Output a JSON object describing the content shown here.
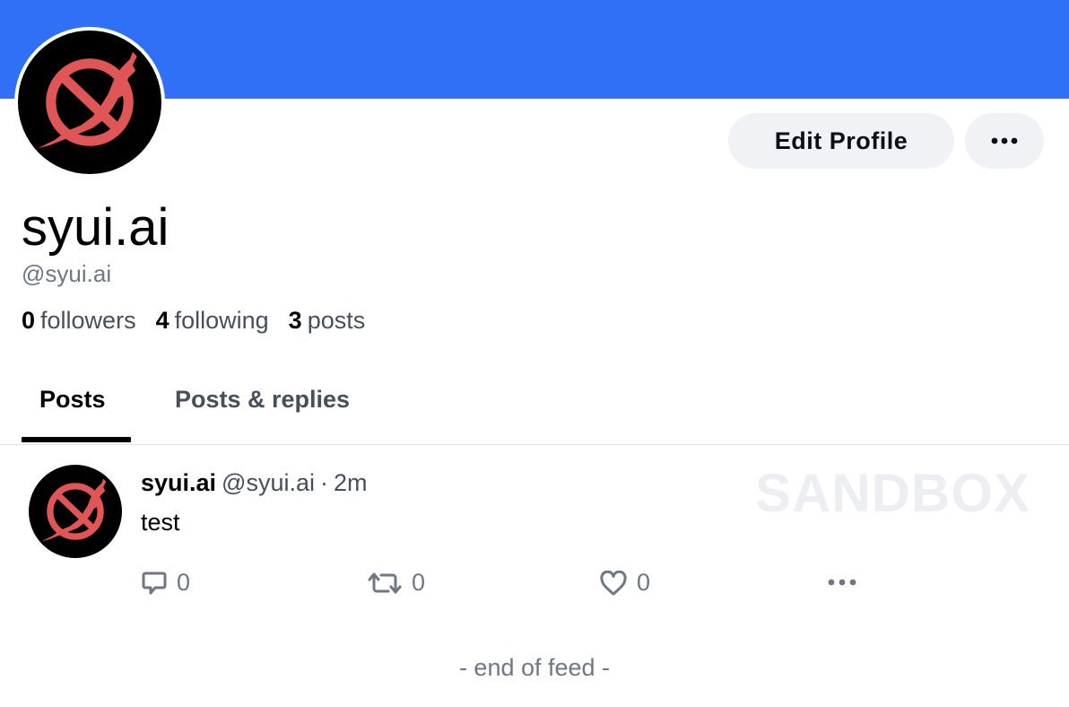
{
  "colors": {
    "banner": "#3070f6",
    "avatar_logo": "#e05656",
    "avatar_bg": "#000000"
  },
  "profile": {
    "display_name": "syui.ai",
    "handle": "@syui.ai",
    "edit_button": "Edit Profile",
    "more_icon": "ellipsis-icon",
    "avatar_icon": "bird-logo-icon",
    "stats": [
      {
        "count": "0",
        "label": "followers"
      },
      {
        "count": "4",
        "label": "following"
      },
      {
        "count": "3",
        "label": "posts"
      }
    ]
  },
  "tabs": [
    {
      "label": "Posts",
      "active": true
    },
    {
      "label": "Posts & replies",
      "active": false
    }
  ],
  "feed": {
    "posts": [
      {
        "author": "syui.ai",
        "handle": "@syui.ai",
        "separator": "·",
        "time": "2m",
        "text": "test",
        "watermark": "SANDBOX",
        "reply_count": "0",
        "repost_count": "0",
        "like_count": "0"
      }
    ],
    "end_text": "- end of feed -"
  }
}
